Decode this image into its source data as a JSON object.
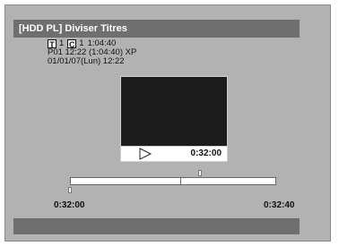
{
  "header": {
    "title": "[HDD PL] Diviser Titres"
  },
  "info": {
    "title_icon": "T",
    "title_number": "1",
    "chapter_icon": "C",
    "chapter_number": "1",
    "chapter_time": "1:04:40",
    "playlist_line": "P01 12:22 (1:04:40) XP",
    "date_line": "01/01/07(Lun)  12:22"
  },
  "preview": {
    "play_icon": "play-icon",
    "current_time": "0:32:00"
  },
  "timeline": {
    "start_time": "0:32:00",
    "end_time": "0:32:40"
  },
  "colors": {
    "screen_bg": "#b2b2b2",
    "bar_bg": "#6f6f6f",
    "preview_bg": "#1c1c1c"
  }
}
